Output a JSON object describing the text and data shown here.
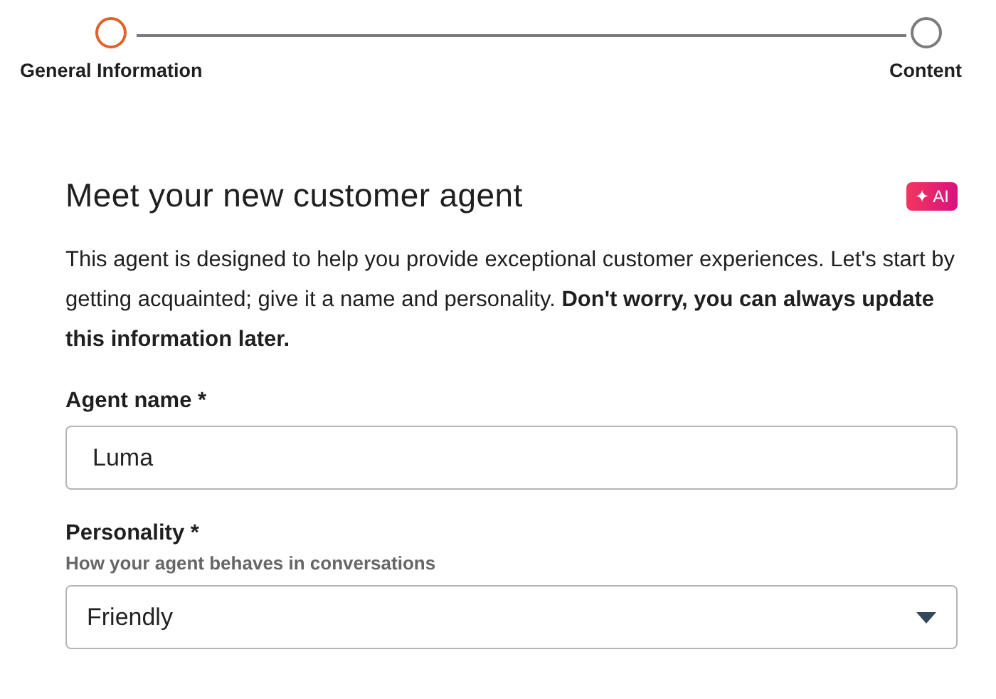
{
  "stepper": {
    "steps": [
      {
        "label": "General Information",
        "selected": true
      },
      {
        "label": "Content",
        "selected": false
      }
    ]
  },
  "title": "Meet your new customer agent",
  "ai_badge": {
    "icon": "✦",
    "label": "AI"
  },
  "description": "This agent is designed to help you provide exceptional customer experiences. Let's start by getting acquainted; give it a name and personality. **Don't worry, you can always update this information later.**",
  "fields": [
    {
      "kind": "text",
      "label": "Agent name *",
      "value": "Luma"
    },
    {
      "kind": "select",
      "label": "Personality *",
      "hint": "How your agent behaves in conversations",
      "value": "Friendly"
    }
  ]
}
